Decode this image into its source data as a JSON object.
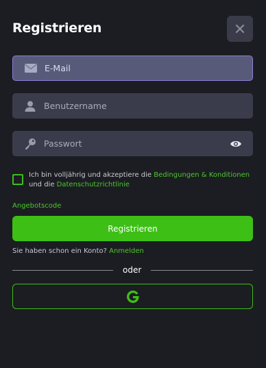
{
  "dialog": {
    "title": "Registrieren"
  },
  "form": {
    "email_placeholder": "E-Mail",
    "username_placeholder": "Benutzername",
    "password_placeholder": "Passwort",
    "terms_prefix": "Ich bin volljährig und akzeptiere die",
    "terms_link": "Bedingungen & Konditionen",
    "terms_middle": "und die",
    "privacy_link": "Datenschutzrichtlinie",
    "promo_code_label": "Angebotscode",
    "submit_label": "Registrieren"
  },
  "login": {
    "prompt": "Sie haben schon ein Konto?",
    "link": "Anmelden"
  },
  "divider": {
    "text": "oder"
  },
  "icons": {
    "close": "close-icon",
    "email": "envelope-icon",
    "user": "user-icon",
    "password": "key-icon",
    "show_password": "eye-icon",
    "google": "google-icon"
  },
  "colors": {
    "accent": "#3dbf16",
    "background": "#1c1d22",
    "field": "#3b3c4b",
    "field_active_border": "#8b7fd6"
  }
}
